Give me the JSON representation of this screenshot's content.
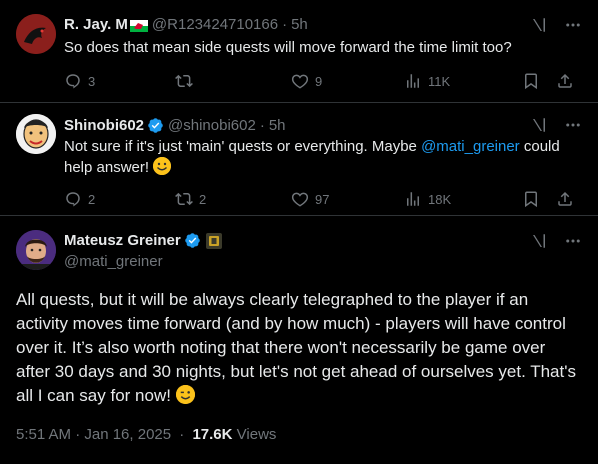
{
  "tweet1": {
    "name": "R. Jay. M",
    "handle": "@R123424710166",
    "time": "5h",
    "text": "So does that mean side quests will move forward the time limit too?",
    "replies": "3",
    "retweets": "",
    "likes": "9",
    "views": "11K"
  },
  "tweet2": {
    "name": "Shinobi602",
    "handle": "@shinobi602",
    "time": "5h",
    "text_before": "Not sure if it's just 'main' quests or everything. Maybe ",
    "mention": "@mati_greiner",
    "text_after": " could help answer!",
    "replies": "2",
    "retweets": "2",
    "likes": "97",
    "views": "18K"
  },
  "tweet3": {
    "name": "Mateusz Greiner",
    "handle": "@mati_greiner",
    "text": "All quests, but it will be always clearly telegraphed to the player if an activity moves time forward (and by how much) - players will have control over it. It’s also worth noting that there won't necessarily be game over after 30 days and 30 nights, but let's not get ahead of ourselves yet. That's all I can say for now!",
    "timestamp": "5:51 AM · Jan 16, 2025",
    "meta_dot": "·",
    "views_count": "17.6K",
    "views_label": "Views"
  },
  "colors": {
    "background": "#000000",
    "text": "#e7e9ea",
    "muted": "#71767b",
    "accent": "#1d9bf0"
  }
}
